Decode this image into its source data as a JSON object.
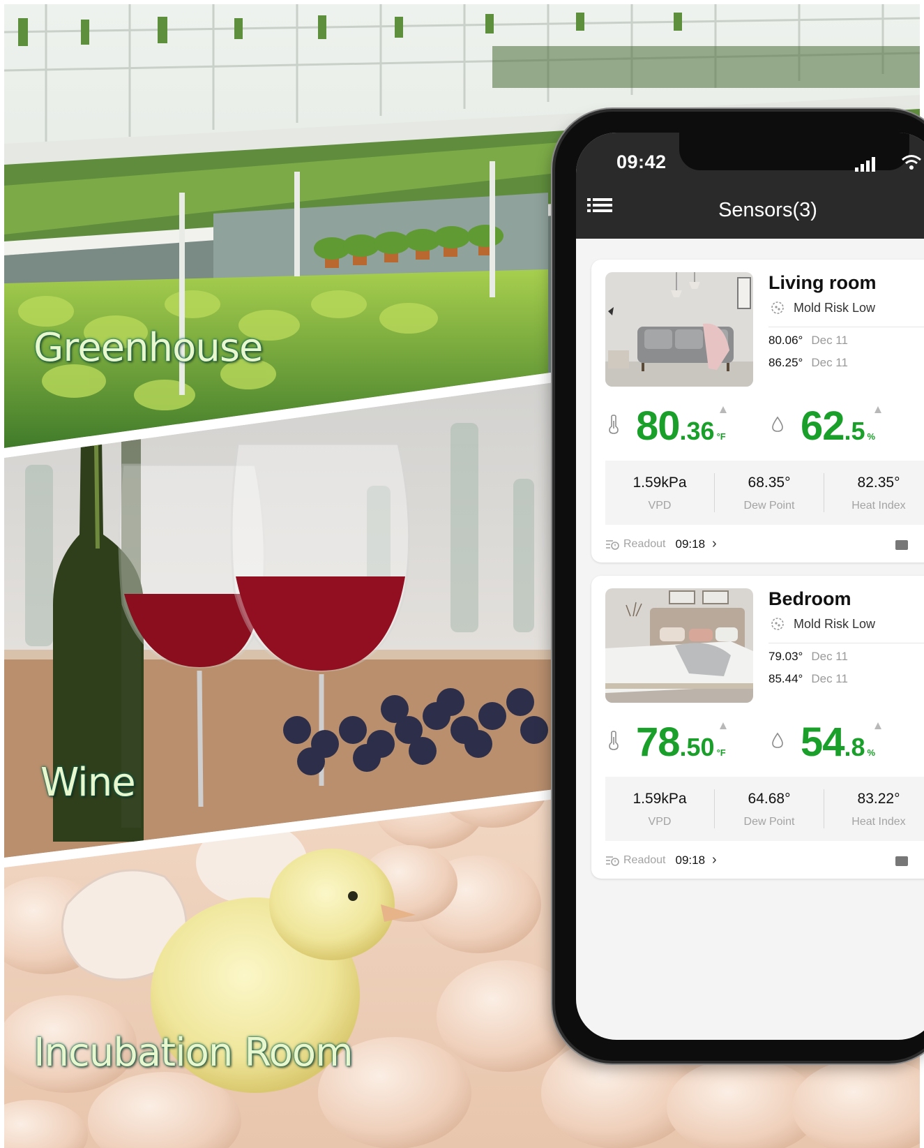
{
  "scenes": {
    "greenhouse_label": "Greenhouse",
    "wine_label": "Wine",
    "incubation_label": "Incubation Room"
  },
  "phone": {
    "status_time": "09:42",
    "app_title": "Sensors(3)"
  },
  "sensors": [
    {
      "name": "Living room",
      "mold_risk": "Mold Risk Low",
      "history": [
        {
          "value": "80.06°",
          "date": "Dec 11"
        },
        {
          "value": "86.25°",
          "date": "Dec 11"
        }
      ],
      "temp_int": "80",
      "temp_frac": ".36",
      "temp_unit": "°F",
      "hum_int": "62",
      "hum_frac": ".5",
      "hum_unit": "%",
      "vpd_value": "1.59kPa",
      "vpd_label": "VPD",
      "dew_value": "68.35°",
      "dew_label": "Dew Point",
      "heat_value": "82.35°",
      "heat_label": "Heat Index",
      "readout_label": "Readout",
      "readout_time": "09:18"
    },
    {
      "name": "Bedroom",
      "mold_risk": "Mold Risk Low",
      "history": [
        {
          "value": "79.03°",
          "date": "Dec 11"
        },
        {
          "value": "85.44°",
          "date": "Dec 11"
        }
      ],
      "temp_int": "78",
      "temp_frac": ".50",
      "temp_unit": "°F",
      "hum_int": "54",
      "hum_frac": ".8",
      "hum_unit": "%",
      "vpd_value": "1.59kPa",
      "vpd_label": "VPD",
      "dew_value": "64.68°",
      "dew_label": "Dew Point",
      "heat_value": "83.22°",
      "heat_label": "Heat Index",
      "readout_label": "Readout",
      "readout_time": "09:18"
    }
  ],
  "colors": {
    "accent_green": "#1aa02a",
    "label_glow": "#0f6a52",
    "app_bar": "#2a2a2a"
  }
}
